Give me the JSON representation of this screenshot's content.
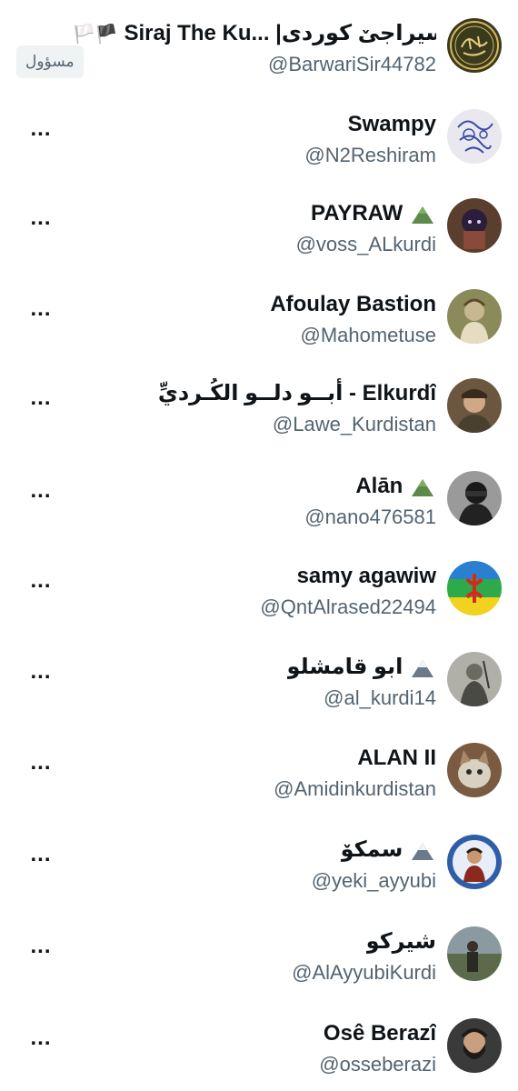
{
  "list": {
    "items": [
      {
        "name": "Siraj The Ku... |سیراجێ کوردی",
        "name_emoji": "🏳️🏴",
        "handle": "@BarwariSir44782",
        "badge": "مسؤول",
        "avatar_bg": "#3a3a1e",
        "avatar_icon": "calligraphy-seal"
      },
      {
        "name": "Swampy",
        "handle": "@N2Reshiram",
        "more": "...",
        "avatar_bg": "#e8e8ee",
        "avatar_icon": "doodle"
      },
      {
        "name": "PAYRAW",
        "name_emoji": "⛰",
        "handle": "@voss_ALkurdi",
        "more": "...",
        "avatar_bg": "#5a3e2e",
        "avatar_icon": "anime-portrait"
      },
      {
        "name": "Afoulay Bastion",
        "handle": "@Mahometuse",
        "more": "...",
        "avatar_bg": "#8a8a5a",
        "avatar_icon": "painting-portrait"
      },
      {
        "name": "أبــو دلــو الكُـرديِّ - Elkurdî",
        "handle": "@Lawe_Kurdistan",
        "more": "...",
        "avatar_bg": "#6b5640",
        "avatar_icon": "photo-portrait"
      },
      {
        "name": "Alān",
        "name_emoji": "⛰",
        "handle": "@nano476581",
        "more": "...",
        "avatar_bg": "#9a9a9a",
        "avatar_icon": "masked-figure"
      },
      {
        "name": "samy agawiw",
        "handle": "@QntAlrased22494",
        "more": "...",
        "avatar_bg": "#2a7fd1",
        "avatar_icon": "amazigh-flag"
      },
      {
        "name": "ابو قامشلو",
        "name_emoji": "🏔",
        "handle": "@al_kurdi14",
        "more": "...",
        "avatar_bg": "#b0b0a8",
        "avatar_icon": "historic-photo"
      },
      {
        "name": "ALAN II",
        "handle": "@Amidinkurdistan",
        "more": "...",
        "avatar_bg": "#7a5a40",
        "avatar_icon": "cat"
      },
      {
        "name": "سمکۆ",
        "name_emoji": "🏔",
        "handle": "@yeki_ayyubi",
        "more": "...",
        "avatar_bg": "#2f5ea8",
        "avatar_icon": "portrait-blue"
      },
      {
        "name": "شيركو",
        "handle": "@AlAyyubiKurdi",
        "more": "...",
        "avatar_bg": "#6a7a5a",
        "avatar_icon": "landscape-figure"
      },
      {
        "name": "Osê Berazî",
        "handle": "@osseberazi",
        "more": "...",
        "avatar_bg": "#3a3a3a",
        "avatar_icon": "bearded-man"
      }
    ]
  },
  "colors": {
    "text": "#0f1419",
    "secondary": "#536471",
    "badge_bg": "#eff3f4"
  }
}
